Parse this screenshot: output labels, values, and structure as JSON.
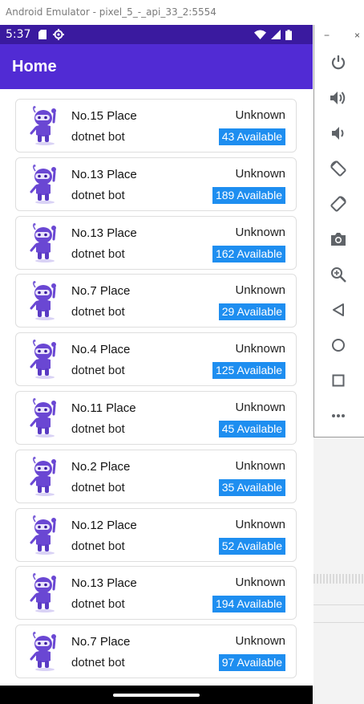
{
  "window": {
    "title": "Android Emulator - pixel_5_-_api_33_2:5554"
  },
  "statusbar": {
    "time": "5:37"
  },
  "appbar": {
    "title": "Home"
  },
  "items": [
    {
      "title": "No.15 Place",
      "subtitle": "dotnet bot",
      "status": "Unknown",
      "available": "43 Available"
    },
    {
      "title": "No.13 Place",
      "subtitle": "dotnet bot",
      "status": "Unknown",
      "available": "189 Available"
    },
    {
      "title": "No.13 Place",
      "subtitle": "dotnet bot",
      "status": "Unknown",
      "available": "162 Available"
    },
    {
      "title": "No.7 Place",
      "subtitle": "dotnet bot",
      "status": "Unknown",
      "available": "29 Available"
    },
    {
      "title": "No.4 Place",
      "subtitle": "dotnet bot",
      "status": "Unknown",
      "available": "125 Available"
    },
    {
      "title": "No.11 Place",
      "subtitle": "dotnet bot",
      "status": "Unknown",
      "available": "45 Available"
    },
    {
      "title": "No.2 Place",
      "subtitle": "dotnet bot",
      "status": "Unknown",
      "available": "35 Available"
    },
    {
      "title": "No.12 Place",
      "subtitle": "dotnet bot",
      "status": "Unknown",
      "available": "52 Available"
    },
    {
      "title": "No.13 Place",
      "subtitle": "dotnet bot",
      "status": "Unknown",
      "available": "194 Available"
    },
    {
      "title": "No.7 Place",
      "subtitle": "dotnet bot",
      "status": "Unknown",
      "available": "97 Available"
    }
  ],
  "toolbar": {
    "window_buttons": [
      "−",
      "×"
    ],
    "buttons": [
      "power-icon",
      "volume-up-icon",
      "volume-down-icon",
      "rotate-left-icon",
      "rotate-right-icon",
      "camera-icon",
      "zoom-icon",
      "back-icon",
      "home-icon",
      "overview-icon",
      "more-icon"
    ]
  },
  "colors": {
    "statusbar": "#3a1a9f",
    "appbar": "#512bd4",
    "badge": "#1e8ef0"
  }
}
